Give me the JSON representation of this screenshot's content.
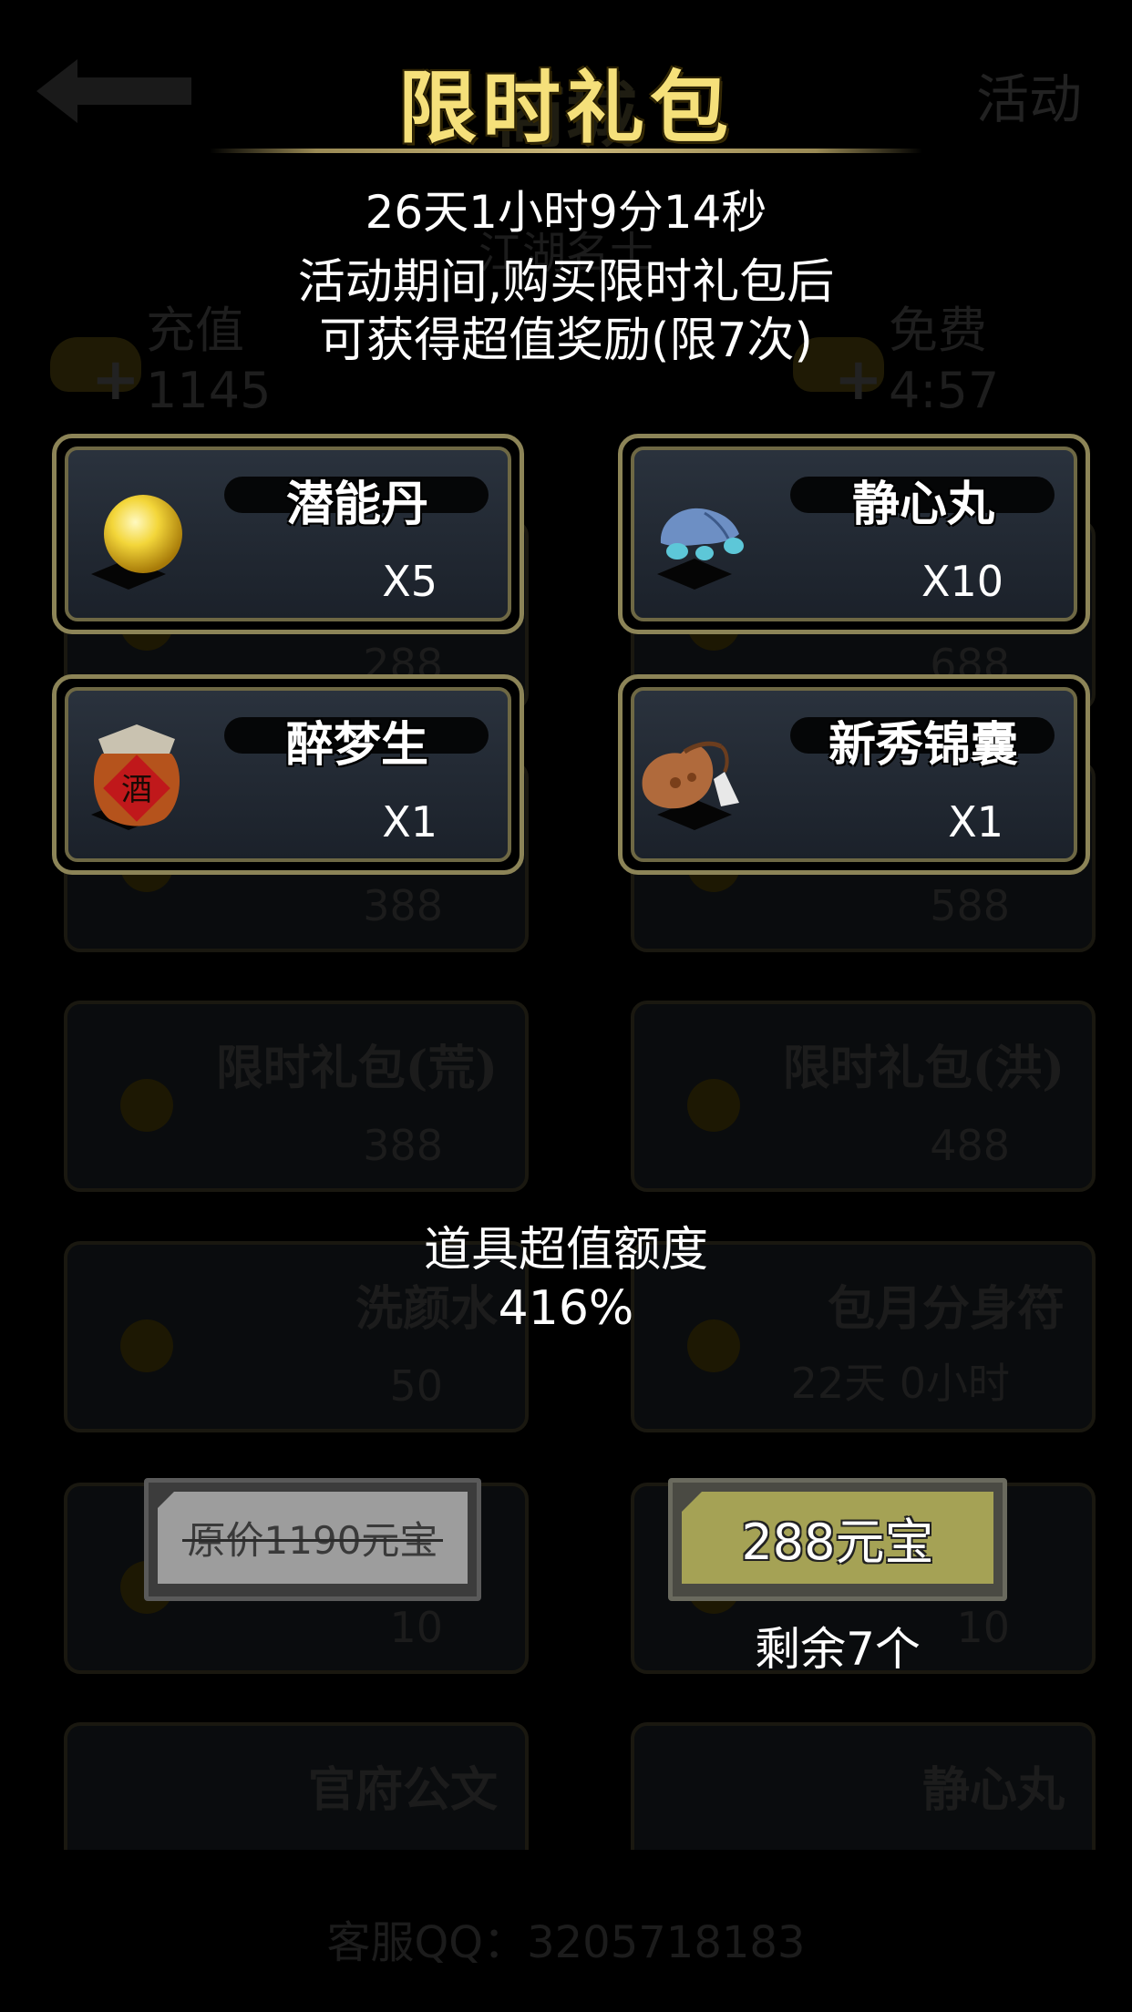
{
  "background": {
    "page_title": "商城",
    "activity_label": "活动",
    "jianghu_label": "江湖名士",
    "recharge_label": "充值",
    "recharge_value": "1145",
    "free_label": "免费",
    "free_value": "4:57",
    "items": [
      {
        "name": "",
        "price": "288"
      },
      {
        "name": "",
        "price": "688"
      },
      {
        "name": "",
        "price": "388"
      },
      {
        "name": "",
        "price": "588"
      },
      {
        "name": "限时礼包(荒)",
        "price": "388"
      },
      {
        "name": "限时礼包(洪)",
        "price": "488"
      },
      {
        "name": "洗颜水",
        "price": "50"
      },
      {
        "name": "包月分身符",
        "price": "22天 0小时"
      },
      {
        "name": "",
        "price": "10"
      },
      {
        "name": "",
        "price": "10"
      },
      {
        "name": "官府公文",
        "price": ""
      },
      {
        "name": "静心丸",
        "price": ""
      }
    ],
    "support": "客服QQ：3205718183"
  },
  "popup": {
    "title": "限时礼包",
    "countdown": "26天1小时9分14秒",
    "desc_line1": "活动期间,购买限时礼包后",
    "desc_line2": "可获得超值奖励(限7次)",
    "rewards": [
      {
        "name": "潜能丹",
        "qty": "X5",
        "icon": "golden-pill-icon"
      },
      {
        "name": "静心丸",
        "qty": "X10",
        "icon": "blue-pouch-icon"
      },
      {
        "name": "醉梦生",
        "qty": "X1",
        "icon": "wine-jar-icon"
      },
      {
        "name": "新秀锦囊",
        "qty": "X1",
        "icon": "brocade-bag-icon"
      }
    ],
    "value_label": "道具超值额度",
    "value_percent": "416%",
    "original_price": "原价1190元宝",
    "buy_price": "288元宝",
    "remaining": "剩余7个"
  },
  "colors": {
    "title_gold": "#f5e07a",
    "card_border": "#8c8457",
    "buy_button": "#a5a255",
    "orig_button": "#9d9d9d"
  }
}
